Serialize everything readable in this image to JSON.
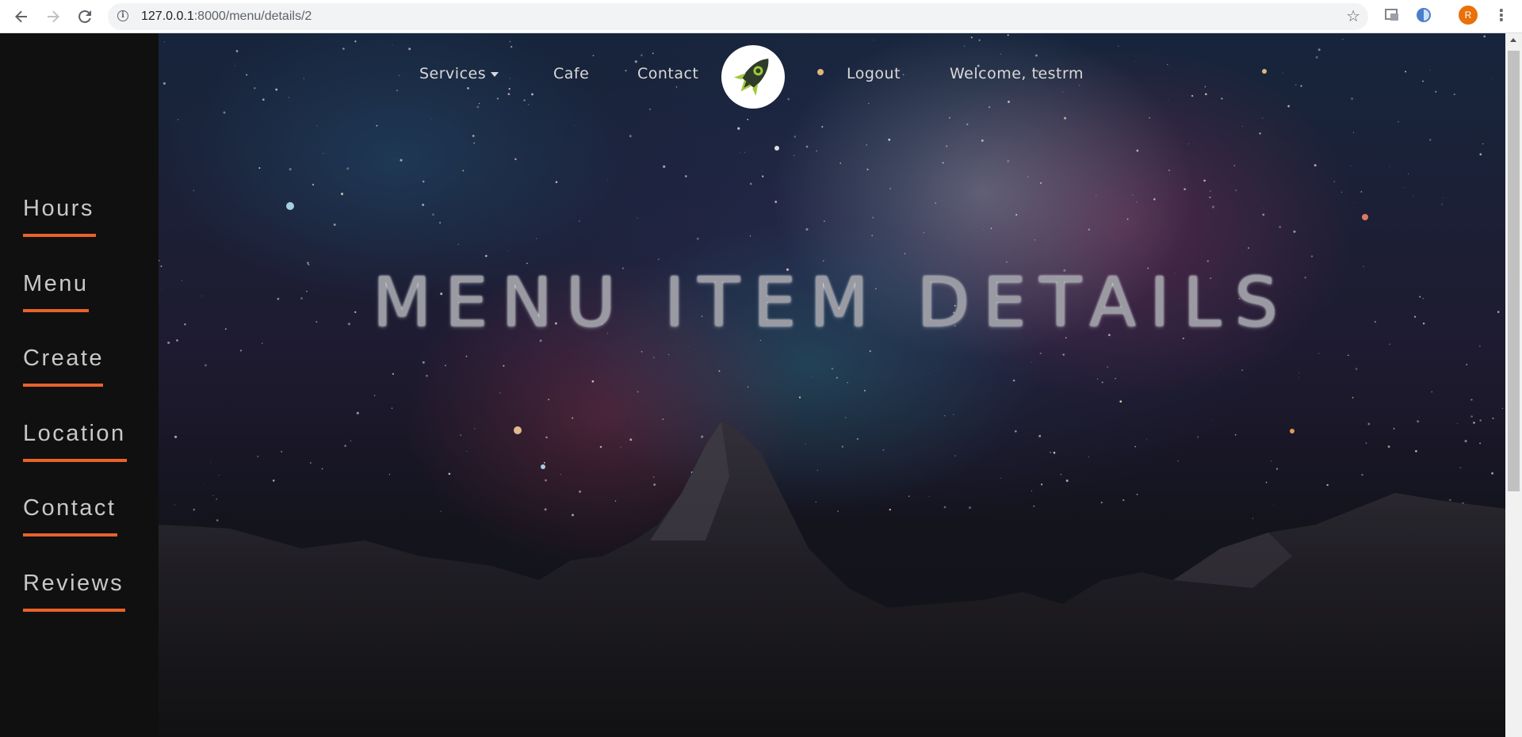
{
  "browser": {
    "url_host": "127.0.0.1",
    "url_path": ":8000/menu/details/2",
    "profile_initial": "R",
    "icons": [
      "back-icon",
      "forward-icon",
      "reload-icon",
      "info-icon",
      "star-icon",
      "extension-icon",
      "extension-icon",
      "menu-dots-icon"
    ]
  },
  "sidebar": {
    "items": [
      {
        "label": "Hours"
      },
      {
        "label": "Menu"
      },
      {
        "label": "Create"
      },
      {
        "label": "Location"
      },
      {
        "label": "Contact"
      },
      {
        "label": "Reviews"
      }
    ],
    "accent_color": "#e8622a"
  },
  "topnav": {
    "services": "Services",
    "cafe": "Cafe",
    "contact": "Contact",
    "logout": "Logout",
    "welcome": "Welcome, testrm",
    "logo_icon": "rocket-icon"
  },
  "hero": {
    "title": "MENU ITEM DETAILS"
  }
}
